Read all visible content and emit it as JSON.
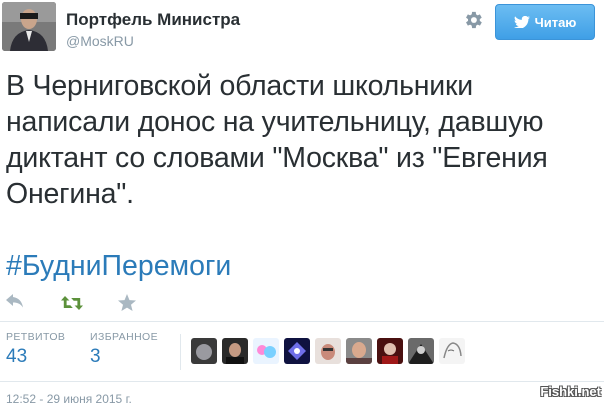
{
  "author": {
    "name": "Портфель Министра",
    "handle": "@MoskRU"
  },
  "follow_button": {
    "label": "Читаю",
    "color": "#4aa8ec"
  },
  "tweet": {
    "text": "В Черниговской области школьники написали донос на учительницу, давшую диктант со словами \"Москва\" из \"Евгения Онегина\".",
    "hashtag": "#БудниПеремоги"
  },
  "actions": [
    {
      "icon": "reply-icon"
    },
    {
      "icon": "retweet-icon",
      "color": "#5c913b"
    },
    {
      "icon": "favorite-icon"
    }
  ],
  "stats": {
    "retweets_label": "РЕТВИТОВ",
    "retweets_value": "43",
    "favorites_label": "ИЗБРАННОЕ",
    "favorites_value": "3"
  },
  "timestamp": "12:52 - 29 июня 2015 г.",
  "watermark": "Fishki.net",
  "colors": {
    "text": "#292f33",
    "muted": "#8899a6",
    "link": "#2b7bb9",
    "border": "#e1e8ed"
  }
}
